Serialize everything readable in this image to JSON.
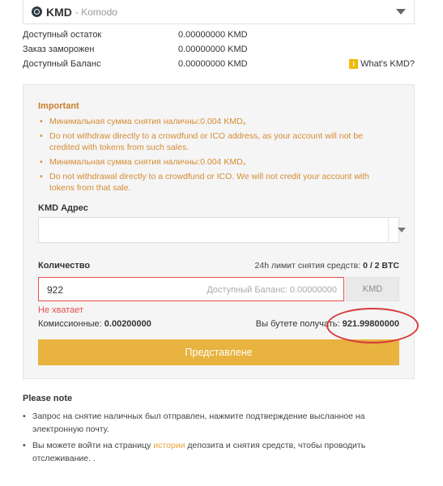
{
  "coin": {
    "icon": "komodo-logo-icon",
    "symbol": "KMD",
    "name_dash": "- Komodo"
  },
  "balances": [
    {
      "label": "Доступный остаток",
      "value": "0.00000000 KMD"
    },
    {
      "label": "Заказ заморожен",
      "value": "0.00000000 KMD"
    },
    {
      "label": "Доступный Баланс",
      "value": "0.00000000 KMD"
    }
  ],
  "whats_kmd": "What's KMD?",
  "important": {
    "title": "Important",
    "items": [
      "Минимальная сумма снятия наличны:0.004 KMD。",
      "Do not withdraw directly to a crowdfund or ICO address, as your account will not be credited with tokens from such sales.",
      "Минимальная сумма снятия наличны:0.004 KMD。",
      "Do not withdrawal directly to a crowdfund or ICO. We will not credit your account with tokens from that sale."
    ]
  },
  "address": {
    "label": "KMD Адрес",
    "value": "",
    "placeholder": ""
  },
  "quantity": {
    "label": "Количество",
    "limit_prefix": "24h лимит снятия средств: ",
    "limit_value": "0 / 2 BTC",
    "value": "922",
    "available_hint": "Доступный Баланс: 0.00000000",
    "unit": "KMD",
    "error": "Не хватает"
  },
  "fee": {
    "label": "Комиссионные: ",
    "value": "0.00200000"
  },
  "receive": {
    "label": "Вы бутете получать: ",
    "value": "921.99800000"
  },
  "submit_label": "Представлене",
  "note": {
    "title": "Please note",
    "item1": "Запрос на снятие наличных был отправлен, нажмите подтверждение высланное на электронную почту.",
    "item2_before": "Вы можете войти на страницу ",
    "item2_link": "истории",
    "item2_after": " депозита и снятия средств, чтобы проводить отслеживание. ."
  },
  "colors": {
    "accent": "#e8b33e",
    "warning_text": "#d58b34",
    "error": "#e94f4f",
    "annotation": "#d63b3b"
  }
}
